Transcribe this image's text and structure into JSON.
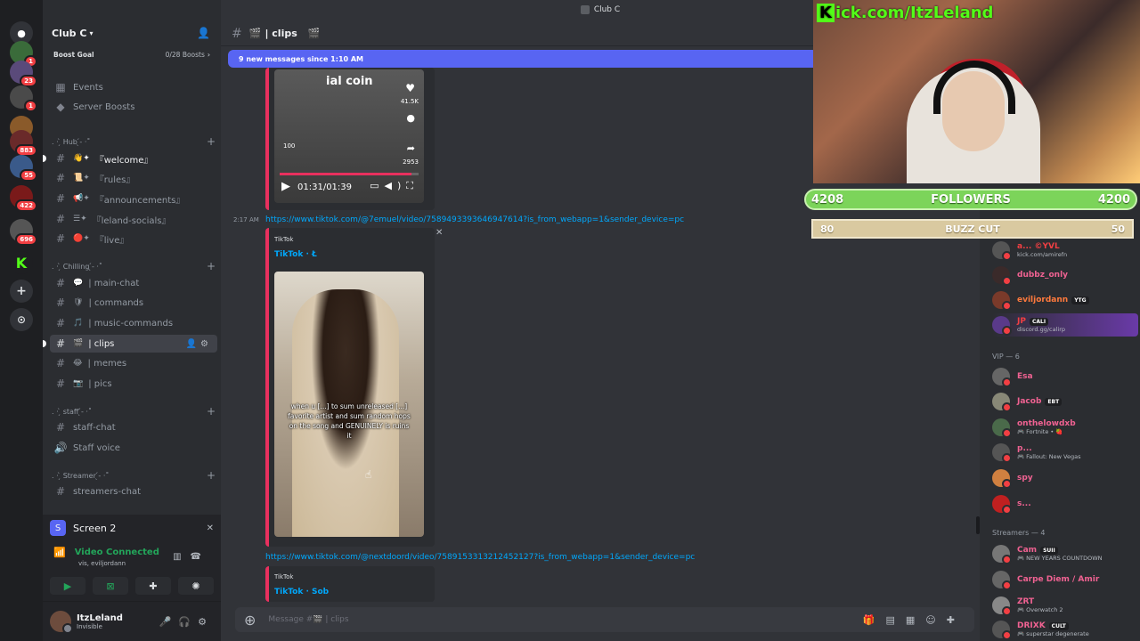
{
  "window": {
    "title": "Club C"
  },
  "server": {
    "name": "Club C",
    "boost_goal_label": "Boost Goal",
    "boost_count": "0/28 Boosts",
    "badges": [
      "1",
      "23",
      "1",
      "883",
      "55",
      "422",
      "696"
    ]
  },
  "sidebar": {
    "top_items": [
      {
        "label": "Events",
        "icon": "calendar-icon"
      },
      {
        "label": "Server Boosts",
        "icon": "boost-icon"
      }
    ],
    "categories": [
      {
        "label": ". · ̗̀ Hub ̖́- ·˚",
        "channels": [
          {
            "label": "『welcome』",
            "emoji": "👋✦"
          },
          {
            "label": "『rules』",
            "emoji": "📜✦"
          },
          {
            "label": "『announcements』",
            "emoji": "📢✦"
          },
          {
            "label": "『leland-socials』",
            "emoji": "☰✦"
          },
          {
            "label": "『live』",
            "emoji": "🔴✦"
          }
        ]
      },
      {
        "label": ". · ̗̀ Chilling ̖́- ·˚",
        "channels": [
          {
            "label": "| main-chat",
            "emoji": "💬"
          },
          {
            "label": "| commands",
            "emoji": "🛡"
          },
          {
            "label": "| music-commands",
            "emoji": "🎵"
          },
          {
            "label": "| clips",
            "emoji": "🎬"
          },
          {
            "label": "| memes",
            "emoji": "😂"
          },
          {
            "label": "| pics",
            "emoji": "📷"
          }
        ]
      },
      {
        "label": ". · ̗̀ staff ̖́- ·˚",
        "channels": [
          {
            "label": "staff-chat",
            "emoji": ""
          },
          {
            "label": "Staff voice",
            "emoji": ""
          }
        ]
      },
      {
        "label": ". · ̗̀ Streamer ̖́- ·˚",
        "channels": [
          {
            "label": "streamers-chat",
            "emoji": ""
          }
        ]
      }
    ]
  },
  "voice": {
    "screen_label": "Screen 2",
    "status": "Video Connected",
    "sub": "vis, eviljordann"
  },
  "user": {
    "name": "ItzLeland",
    "status": "Invisible"
  },
  "channel": {
    "name": "| clips"
  },
  "banner": "9 new messages since 1:10 AM",
  "messages": [
    {
      "video_caption": "ial coin",
      "likes": "41.5K",
      "shares": "2953",
      "counter": "100",
      "time": "01:31/01:39"
    },
    {
      "timestamp": "2:17 AM",
      "link": "https://www.tiktok.com/@7emuel/video/7589493393646947614?is_from_webapp=1&sender_device=pc",
      "provider": "TikTok",
      "title": "TikTok · Ł",
      "video_caption": "when u [...] to sum unreleased [...] favorite artist and sum random hops on the song and GENUINELY is ruins it"
    },
    {
      "link": "https://www.tiktok.com/@nextdoord/video/7589153313212452127?is_from_webapp=1&sender_device=pc",
      "provider": "TikTok",
      "title": "TikTok · Sob"
    }
  ],
  "composer": {
    "placeholder": "Message #🎬 | clips"
  },
  "members": {
    "top": [
      {
        "name": "a... ©YVL",
        "activity": "kick.com/amirefn",
        "color": "#f23f43"
      },
      {
        "name": "dubbz_only",
        "activity": "",
        "color": "#f06292"
      },
      {
        "name": "eviljordann",
        "tag": "YTG",
        "activity": "",
        "color": "#ff7a3d"
      },
      {
        "name": "JP",
        "tag": "CALI",
        "activity": "discord.gg/calirp",
        "color": "#f23f43"
      }
    ],
    "vip_label": "VIP — 6",
    "vip": [
      {
        "name": "Esa",
        "activity": "",
        "color": "#f06292"
      },
      {
        "name": "Jacob",
        "tag": "EBT",
        "activity": "",
        "color": "#f06292"
      },
      {
        "name": "onthelowdxb",
        "activity": "🎮 Fortnite • 🍓",
        "color": "#f06292"
      },
      {
        "name": "p...",
        "activity": "🎮 Fallout: New Vegas",
        "color": "#f06292"
      },
      {
        "name": "spy",
        "activity": "",
        "color": "#f06292"
      },
      {
        "name": "s...",
        "activity": "",
        "color": "#f06292"
      }
    ],
    "streamers_label": "Streamers — 4",
    "streamers": [
      {
        "name": "Cam",
        "tag": "SUII",
        "activity": "🎮 NEW YEARS COUNTDOWN",
        "color": "#f06292"
      },
      {
        "name": "Carpe Diem / Amir",
        "activity": "",
        "color": "#f06292"
      },
      {
        "name": "ZRT",
        "activity": "🎮 Overwatch 2",
        "color": "#f06292"
      },
      {
        "name": "DRIXK",
        "tag": "CULT",
        "activity": "🎮 superstar degenerate",
        "color": "#f06292"
      }
    ]
  },
  "overlay": {
    "kick_text": "ick.com/ItzLeland",
    "kick_k": "K",
    "followers_left": "4208",
    "followers_label": "FOLLOWERS",
    "followers_right": "4200",
    "buzz_left": "80",
    "buzz_label": "BUZZ CUT",
    "buzz_right": "50"
  }
}
